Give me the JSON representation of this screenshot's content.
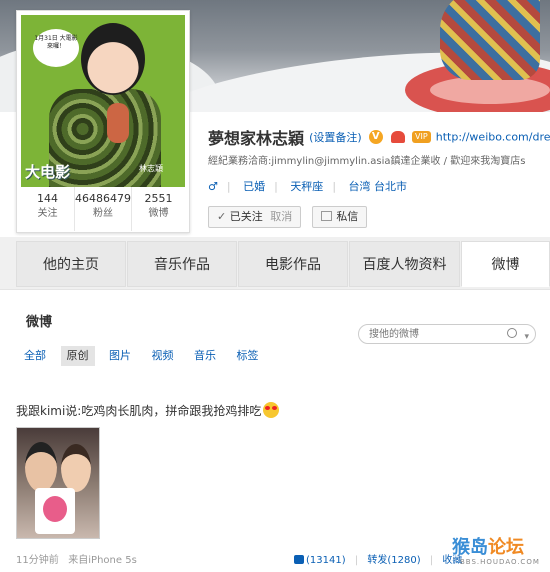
{
  "profile": {
    "avatar_caption_text": "大电影",
    "avatar_bubble_text": "1月31日 大電影 來囉！",
    "avatar_name_sign": "林志穎",
    "stats": [
      {
        "value": "144",
        "label": "关注"
      },
      {
        "value": "46486479",
        "label": "粉丝"
      },
      {
        "value": "2551",
        "label": "微博"
      }
    ],
    "name": "夢想家林志穎",
    "remark_link": "(设置备注)",
    "verified_mark": "V",
    "vip_label": "VIP",
    "url": "http://weibo.com/dre",
    "description": "經紀業務洽商:jimmylin@jimmylin.asia鎮達企業收 / 歡迎來我淘寶店s",
    "gender_symbol": "♂",
    "marital": "已婚",
    "zodiac": "天秤座",
    "location": "台湾 台北市",
    "followed_button": "已关注",
    "cancel_label": "取消",
    "message_button": "私信"
  },
  "tabs": [
    "他的主页",
    "音乐作品",
    "电影作品",
    "百度人物资料",
    "微博"
  ],
  "active_tab": 4,
  "feed": {
    "title": "微博",
    "search_placeholder": "搜他的微博",
    "filters": [
      "全部",
      "原创",
      "图片",
      "视频",
      "音乐",
      "标签"
    ],
    "active_filter": 1
  },
  "post": {
    "text": "我跟kimi说:吃鸡肉长肌肉，拼命跟我抢鸡排吃",
    "time": "11分钟前",
    "source": "来自iPhone 5s",
    "likes": "(13141)",
    "repost": "转发(1280)",
    "favorite": "收藏"
  },
  "watermark": {
    "main_a": "猴岛",
    "main_b": "论坛",
    "sub": "BBS.HOUDAO.COM"
  },
  "colors": {
    "link": "#0a5fb4",
    "avatar_bg": "#7db437",
    "accent_orange": "#f5a623"
  }
}
